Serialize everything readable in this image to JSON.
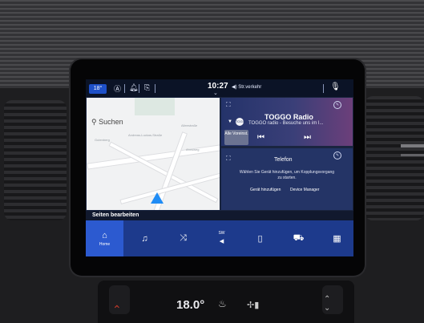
{
  "status_bar": {
    "temperature": "18°",
    "time": "10:27",
    "traffic_label": "Str.verkehr"
  },
  "map": {
    "search_placeholder": "Suchen",
    "labels": [
      "Andreas-Luckas-Straße",
      "Alleestraße",
      "Gutenberg",
      "Ahnsweg"
    ]
  },
  "radio": {
    "station": "TOGGO Radio",
    "subtitle": "TOGGO radio - Besuche uns im I...",
    "logo_text": "TOGGO",
    "presets_label": "Alle Voreinst."
  },
  "telefon": {
    "title": "Telefon",
    "message": "Wählen Sie Gerät hinzufügen, um Kopplungsvorgang zu starten.",
    "add_device": "Gerät hinzufügen",
    "device_manager": "Device Manager"
  },
  "edit_bar": {
    "label": "Seiten bearbeiten"
  },
  "dock": {
    "items": [
      {
        "icon": "home-icon",
        "label": "Home"
      },
      {
        "icon": "music-icon",
        "label": ""
      },
      {
        "icon": "climate-seat-icon",
        "label": ""
      },
      {
        "icon": "navigation-icon",
        "label": "SW"
      },
      {
        "icon": "phone-icon",
        "label": ""
      },
      {
        "icon": "vehicle-icon",
        "label": ""
      },
      {
        "icon": "apps-grid-icon",
        "label": ""
      }
    ]
  },
  "climate": {
    "temperature": "18.0°"
  },
  "colors": {
    "dock": "#1d3a8c",
    "dock_active": "#2c5ad0",
    "card": "#243466",
    "accent": "#1e50c8"
  }
}
